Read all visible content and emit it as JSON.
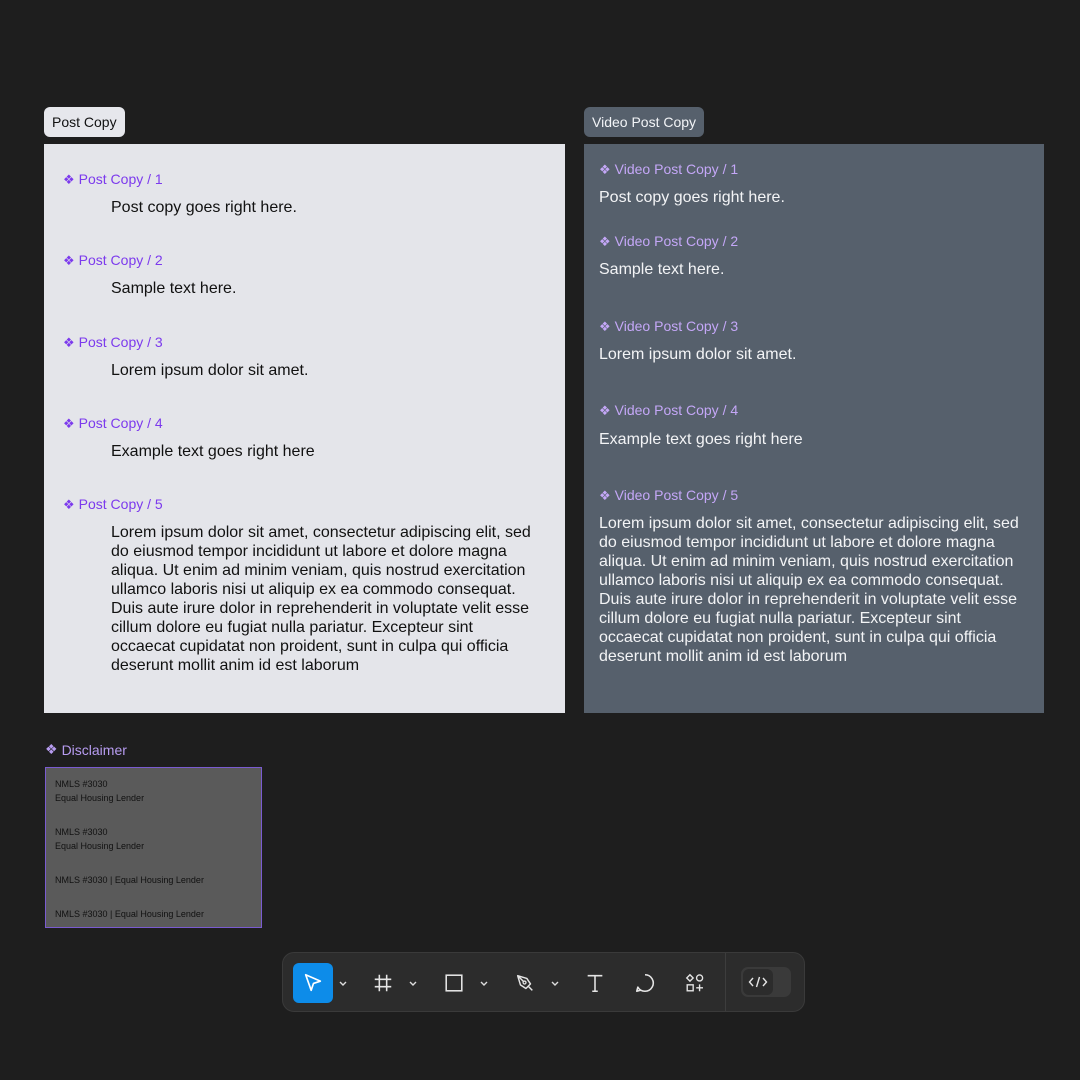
{
  "post_frame": {
    "tab_label": "Post Copy",
    "items": [
      {
        "label": "Post Copy / 1",
        "text": "Post copy goes right here."
      },
      {
        "label": "Post Copy / 2",
        "text": "Sample text here."
      },
      {
        "label": "Post Copy / 3",
        "text": "Lorem ipsum dolor sit amet."
      },
      {
        "label": "Post Copy / 4",
        "text": "Example text goes right here"
      },
      {
        "label": "Post Copy / 5",
        "text": "Lorem ipsum dolor sit amet, consectetur adipiscing elit, sed do eiusmod tempor incididunt ut labore et dolore magna aliqua. Ut enim ad minim veniam, quis nostrud exercitation ullamco laboris nisi ut aliquip ex ea commodo consequat. Duis aute irure dolor in reprehenderit in voluptate velit esse cillum dolore eu fugiat nulla pariatur. Excepteur sint occaecat cupidatat non proident, sunt in culpa qui officia deserunt mollit anim id est laborum"
      }
    ]
  },
  "video_frame": {
    "tab_label": "Video Post Copy",
    "items": [
      {
        "label": "Video Post Copy / 1",
        "text": "Post copy goes right here."
      },
      {
        "label": "Video Post Copy / 2",
        "text": "Sample text here."
      },
      {
        "label": "Video Post Copy / 3",
        "text": "Lorem ipsum dolor sit amet."
      },
      {
        "label": "Video Post Copy / 4",
        "text": "Example text goes right here"
      },
      {
        "label": "Video Post Copy / 5",
        "text": "Lorem ipsum dolor sit amet, consectetur adipiscing elit, sed do eiusmod tempor incididunt ut labore et dolore magna aliqua. Ut enim ad minim veniam, quis nostrud exercitation ullamco laboris nisi ut aliquip ex ea commodo consequat. Duis aute irure dolor in reprehenderit in voluptate velit esse cillum dolore eu fugiat nulla pariatur. Excepteur sint occaecat cupidatat non proident, sunt in culpa qui officia deserunt mollit anim id est laborum"
      }
    ]
  },
  "disclaimer": {
    "label": "Disclaimer",
    "lines": [
      "NMLS #3030",
      "Equal Housing Lender",
      "NMLS #3030",
      "Equal Housing Lender",
      "NMLS #3030 | Equal Housing Lender",
      "NMLS #3030 | Equal Housing Lender"
    ]
  },
  "icons": {
    "component": "component-icon",
    "toolbar": [
      "move-tool-icon",
      "frame-tool-icon",
      "rectangle-tool-icon",
      "pen-tool-icon",
      "text-tool-icon",
      "comment-tool-icon",
      "actions-icon",
      "dev-mode-icon"
    ]
  },
  "colors": {
    "canvas": "#1e1e1e",
    "component_purple": "#7c3aed",
    "toolbar_active": "#0d8ce9"
  }
}
